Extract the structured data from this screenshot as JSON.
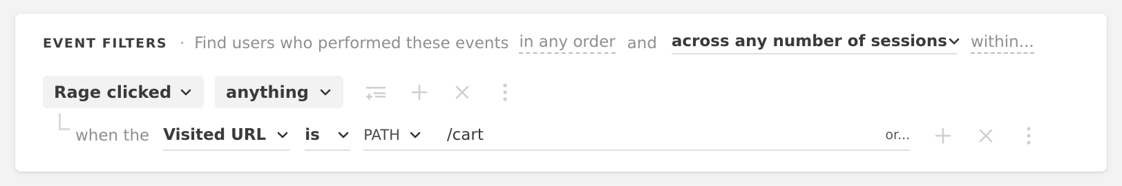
{
  "event_filters": {
    "title": "EVENT FILTERS",
    "separator": "·",
    "description": "Find users who performed these events",
    "order_option": "in any order",
    "conjunction": "and",
    "sessions_option": "across any number of sessions",
    "within_option": "within..."
  },
  "filter_row": {
    "event_label": "Rage clicked",
    "target_label": "anything"
  },
  "condition_row": {
    "prefix": "when the",
    "property_label": "Visited URL",
    "operator_label": "is",
    "match_type_label": "PATH",
    "value": "/cart",
    "or_label": "or..."
  },
  "icons": {
    "filter_icon": "filter-add-icon",
    "add_icon": "plus-icon",
    "remove_icon": "close-icon",
    "more_icon": "more-vertical-icon"
  },
  "colors": {
    "card_bg": "#ffffff",
    "page_bg": "#f3f3f3",
    "pill_bg": "#f1f2f1",
    "muted_text": "#8f8f8f",
    "icon_muted": "#cfcfcf"
  }
}
